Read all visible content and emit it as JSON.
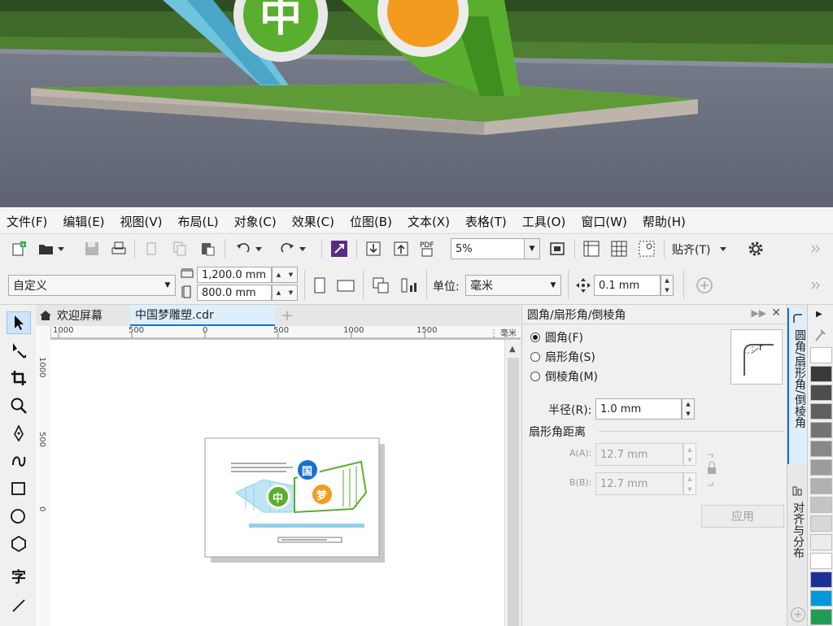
{
  "menu": [
    "文件(F)",
    "编辑(E)",
    "视图(V)",
    "布局(L)",
    "对象(C)",
    "效果(C)",
    "位图(B)",
    "文本(X)",
    "表格(T)",
    "工具(O)",
    "窗口(W)",
    "帮助(H)"
  ],
  "toolbar1": {
    "zoom_value": "5%",
    "snap_label": "贴齐(T)"
  },
  "toolbar2": {
    "preset_value": "自定义",
    "width_value": "1,200.0 mm",
    "height_value": "800.0 mm",
    "units_label": "单位:",
    "units_value": "毫米",
    "nudge_value": "0.1 mm"
  },
  "tabs": {
    "welcome": "欢迎屏幕",
    "document": "中国梦雕塑.cdr"
  },
  "ruler": {
    "h_ticks": [
      "1000",
      "500",
      "0",
      "500",
      "1000",
      "1500"
    ],
    "h_unit": "毫米",
    "v_ticks": [
      "1000",
      "500",
      "0"
    ]
  },
  "docker": {
    "title": "圆角/扇形角/倒棱角",
    "options": [
      "圆角(F)",
      "扇形角(S)",
      "倒棱角(M)"
    ],
    "selected_index": 0,
    "radius_label": "半径(R):",
    "radius_value": "1.0 mm",
    "scallop_distance_label": "扇形角距离",
    "a_label": "A(A):",
    "a_value": "12.7 mm",
    "b_label": "B(B):",
    "b_value": "12.7 mm",
    "apply_label": "应用",
    "preview_letter": "r"
  },
  "vertical_tabs": [
    "圆角/扇形角/倒棱角",
    "对齐与分布"
  ],
  "artwork": {
    "char_guo": "国",
    "char_zhong": "中",
    "char_meng": "梦"
  },
  "colors": {
    "accent_blue": "#1a6fd6",
    "green": "#5aae2e",
    "orange": "#f39b1e",
    "light_blue": "#8fd0ea",
    "palette": [
      "#ffffff",
      "#3a3a3a",
      "#4d4d4d",
      "#606060",
      "#747474",
      "#888888",
      "#9c9c9c",
      "#b0b0b0",
      "#c4c4c4",
      "#d8d8d8",
      "#ececec",
      "#ffffff",
      "#1f2f9a",
      "#0097db",
      "#1f9d55"
    ]
  }
}
